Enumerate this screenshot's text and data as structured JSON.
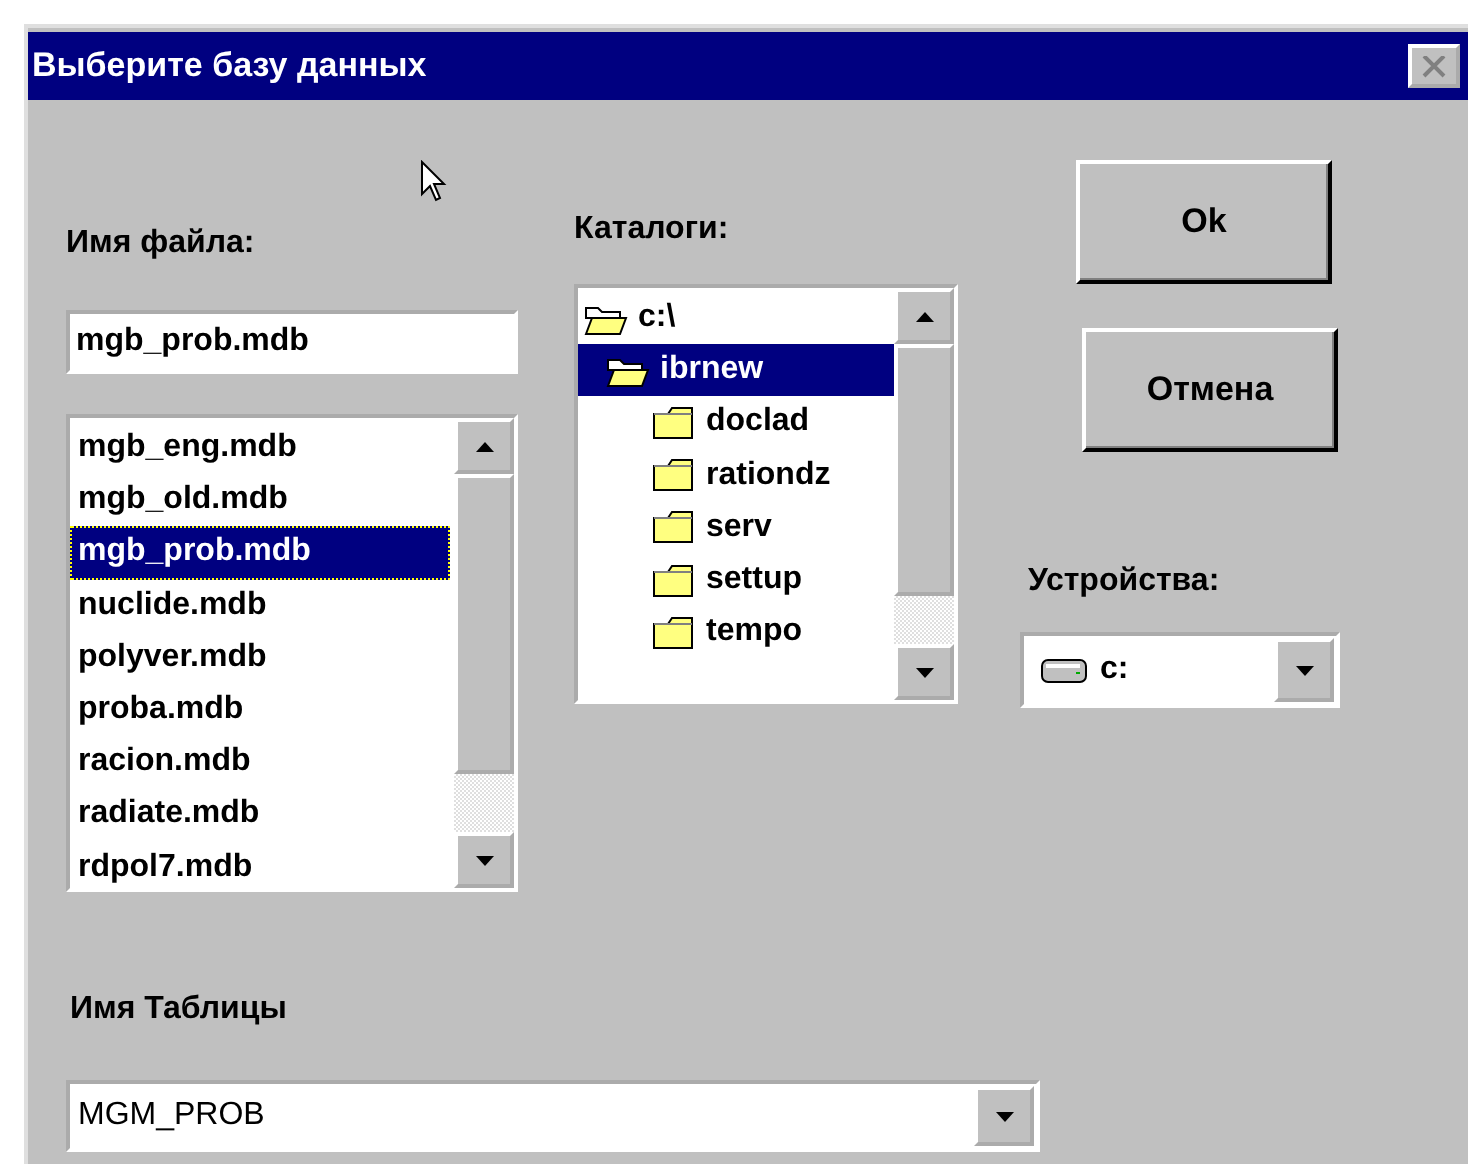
{
  "window": {
    "title": "Выберите базу данных"
  },
  "file_name": {
    "label": "Имя файла:",
    "value": "mgb_prob.mdb"
  },
  "files": [
    {
      "name": "mgb_eng.mdb",
      "selected": false
    },
    {
      "name": "mgb_old.mdb",
      "selected": false
    },
    {
      "name": "mgb_prob.mdb",
      "selected": true
    },
    {
      "name": "nuclide.mdb",
      "selected": false
    },
    {
      "name": "polyver.mdb",
      "selected": false
    },
    {
      "name": "proba.mdb",
      "selected": false
    },
    {
      "name": "racion.mdb",
      "selected": false
    },
    {
      "name": "radiate.mdb",
      "selected": false
    },
    {
      "name": "rdpol7.mdb",
      "selected": false
    }
  ],
  "directories": {
    "label": "Каталоги:",
    "tree": [
      {
        "name": "c:\\",
        "expanded": true,
        "selected": false,
        "children": [
          {
            "name": "ibrnew",
            "expanded": true,
            "selected": true,
            "children": [
              {
                "name": "doclad",
                "expanded": false,
                "selected": false
              },
              {
                "name": "rationdz",
                "expanded": false,
                "selected": false
              },
              {
                "name": "serv",
                "expanded": false,
                "selected": false
              },
              {
                "name": "settup",
                "expanded": false,
                "selected": false
              },
              {
                "name": "tempo",
                "expanded": false,
                "selected": false
              }
            ]
          }
        ]
      }
    ]
  },
  "buttons": [
    "Ok",
    "Отмена"
  ],
  "drives": {
    "label": "Устройства:",
    "value": "c:"
  },
  "table_name": {
    "label": "Имя Таблицы",
    "value": "MGM_PROB"
  }
}
